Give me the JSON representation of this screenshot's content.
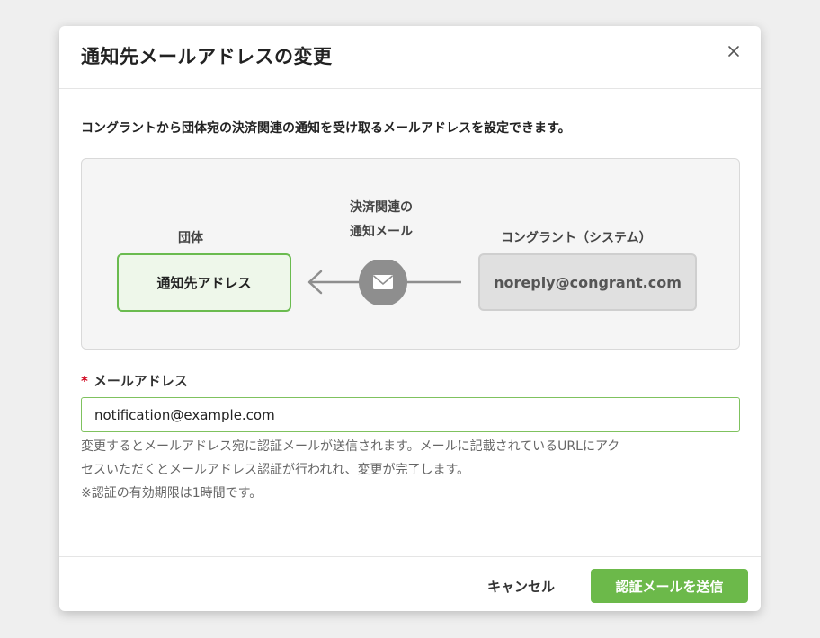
{
  "dialog": {
    "title": "通知先メールアドレスの変更",
    "close_icon": "close-icon",
    "description": "コングラントから団体宛の決済関連の通知を受け取るメールアドレスを設定できます。"
  },
  "diagram": {
    "org_label": "団体",
    "org_box": "通知先アドレス",
    "mail_label_line1": "決済関連の",
    "mail_label_line2": "通知メール",
    "mail_icon": "envelope-icon",
    "arrow_icon": "arrow-left-icon",
    "system_label": "コングラント（システム）",
    "system_box": "noreply@congrant.com"
  },
  "form": {
    "required_mark": "*",
    "email_label": "メールアドレス",
    "email_value": "notification@example.com",
    "help_line1": "変更するとメールアドレス宛に認証メールが送信されます。メールに記載されているURLにアク",
    "help_line2": "セスいただくとメールアドレス認証が行われれ、変更が完了します。",
    "help_line3": "※認証の有効期限は1時間です。"
  },
  "footer": {
    "cancel_label": "キャンセル",
    "submit_label": "認証メールを送信"
  },
  "colors": {
    "accent_green": "#6cb94a",
    "required_red": "#d0021b"
  }
}
